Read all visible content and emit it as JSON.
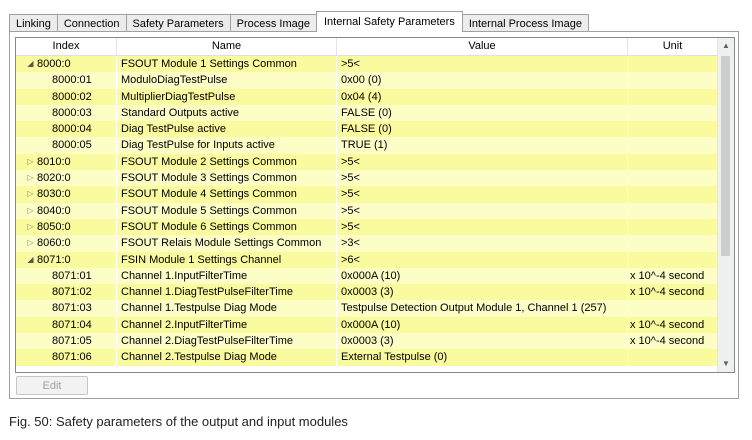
{
  "tabs": [
    {
      "label": "Linking",
      "active": false
    },
    {
      "label": "Connection",
      "active": false
    },
    {
      "label": "Safety Parameters",
      "active": false
    },
    {
      "label": "Process Image",
      "active": false
    },
    {
      "label": "Internal Safety Parameters",
      "active": true
    },
    {
      "label": "Internal Process Image",
      "active": false
    }
  ],
  "table": {
    "headers": {
      "index": "Index",
      "name": "Name",
      "value": "Value",
      "unit": "Unit"
    },
    "rows": [
      {
        "expander": "expanded",
        "level": 0,
        "index": "8000:0",
        "name": "FSOUT Module 1 Settings Common",
        "value": ">5<",
        "unit": ""
      },
      {
        "expander": "",
        "level": 1,
        "index": "8000:01",
        "name": "ModuloDiagTestPulse",
        "value": "0x00 (0)",
        "unit": ""
      },
      {
        "expander": "",
        "level": 1,
        "index": "8000:02",
        "name": "MultiplierDiagTestPulse",
        "value": "0x04 (4)",
        "unit": ""
      },
      {
        "expander": "",
        "level": 1,
        "index": "8000:03",
        "name": "Standard Outputs active",
        "value": "FALSE (0)",
        "unit": ""
      },
      {
        "expander": "",
        "level": 1,
        "index": "8000:04",
        "name": "Diag TestPulse active",
        "value": "FALSE (0)",
        "unit": ""
      },
      {
        "expander": "",
        "level": 1,
        "index": "8000:05",
        "name": "Diag TestPulse for Inputs active",
        "value": "TRUE (1)",
        "unit": ""
      },
      {
        "expander": "collapsed",
        "level": 0,
        "index": "8010:0",
        "name": "FSOUT Module 2 Settings Common",
        "value": ">5<",
        "unit": ""
      },
      {
        "expander": "collapsed",
        "level": 0,
        "index": "8020:0",
        "name": "FSOUT Module 3 Settings Common",
        "value": ">5<",
        "unit": ""
      },
      {
        "expander": "collapsed",
        "level": 0,
        "index": "8030:0",
        "name": "FSOUT Module 4 Settings Common",
        "value": ">5<",
        "unit": ""
      },
      {
        "expander": "collapsed",
        "level": 0,
        "index": "8040:0",
        "name": "FSOUT Module 5 Settings Common",
        "value": ">5<",
        "unit": ""
      },
      {
        "expander": "collapsed",
        "level": 0,
        "index": "8050:0",
        "name": "FSOUT Module 6 Settings Common",
        "value": ">5<",
        "unit": ""
      },
      {
        "expander": "collapsed",
        "level": 0,
        "index": "8060:0",
        "name": "FSOUT Relais Module Settings Common",
        "value": ">3<",
        "unit": ""
      },
      {
        "expander": "expanded",
        "level": 0,
        "index": "8071:0",
        "name": "FSIN Module 1 Settings Channel",
        "value": ">6<",
        "unit": ""
      },
      {
        "expander": "",
        "level": 1,
        "index": "8071:01",
        "name": "Channel 1.InputFilterTime",
        "value": "0x000A (10)",
        "unit": "x 10^-4 second"
      },
      {
        "expander": "",
        "level": 1,
        "index": "8071:02",
        "name": "Channel 1.DiagTestPulseFilterTime",
        "value": "0x0003 (3)",
        "unit": "x 10^-4 second"
      },
      {
        "expander": "",
        "level": 1,
        "index": "8071:03",
        "name": "Channel 1.Testpulse Diag Mode",
        "value": "Testpulse Detection Output Module 1, Channel 1 (257)",
        "unit": ""
      },
      {
        "expander": "",
        "level": 1,
        "index": "8071:04",
        "name": "Channel 2.InputFilterTime",
        "value": "0x000A (10)",
        "unit": "x 10^-4 second"
      },
      {
        "expander": "",
        "level": 1,
        "index": "8071:05",
        "name": "Channel 2.DiagTestPulseFilterTime",
        "value": "0x0003 (3)",
        "unit": "x 10^-4 second"
      },
      {
        "expander": "",
        "level": 1,
        "index": "8071:06",
        "name": "Channel 2.Testpulse Diag Mode",
        "value": "External Testpulse (0)",
        "unit": ""
      }
    ]
  },
  "icons": {
    "expanded": "triangle-down-icon",
    "collapsed": "triangle-right-icon",
    "scroll_up": "chevron-up-icon",
    "scroll_down": "chevron-down-icon"
  },
  "edit_button": {
    "label": "Edit",
    "enabled": false
  },
  "caption": "Fig. 50: Safety parameters of the output and input modules"
}
